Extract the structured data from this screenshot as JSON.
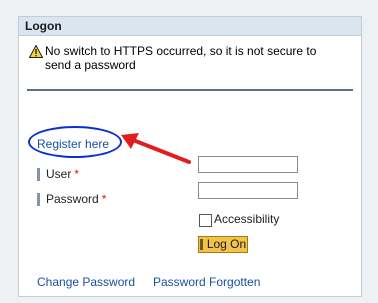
{
  "header": {
    "title": "Logon"
  },
  "warning": {
    "icon": "warning-icon",
    "text": "No switch to HTTPS occurred, so it is not secure to send a password"
  },
  "register": {
    "label": "Register here"
  },
  "form": {
    "user_label": "User",
    "password_label": "Password",
    "required_marker": "*",
    "user_value": "",
    "password_value": "",
    "accessibility_label": "Accessibility",
    "accessibility_checked": false,
    "logon_button": "Log On"
  },
  "footer": {
    "change_password": "Change Password",
    "password_forgotten": "Password Forgotten"
  },
  "colors": {
    "link": "#1b4fa1",
    "button": "#f3c24a",
    "required": "#dd1111",
    "annotation_circle": "#0a2fd6",
    "annotation_arrow": "#e31d1d"
  }
}
